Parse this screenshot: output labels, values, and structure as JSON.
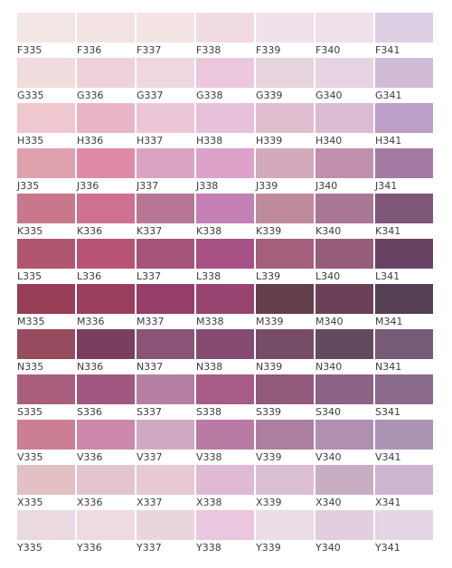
{
  "chart": {
    "rows": [
      {
        "colors": [
          "#f3e7e6",
          "#f3e3e3",
          "#f5e4e4",
          "#efdbe1",
          "#f0e1ea",
          "#efe1e9",
          "#ddd0e5"
        ],
        "codes": [
          "F335",
          "F336",
          "F337",
          "F338",
          "F339",
          "F340",
          "F341"
        ]
      },
      {
        "colors": [
          "#f0dcdc",
          "#efd1da",
          "#efd7e0",
          "#ebc8db",
          "#e8d4de",
          "#e7d3e1",
          "#d1bcd8"
        ],
        "codes": [
          "G335",
          "G336",
          "G337",
          "G338",
          "G339",
          "G340",
          "G341"
        ]
      },
      {
        "colors": [
          "#eec8ce",
          "#e9b5c9",
          "#ecc6d6",
          "#e7c0db",
          "#dfbfcf",
          "#dbbcd2",
          "#bd9ec6"
        ],
        "codes": [
          "H335",
          "H336",
          "H337",
          "H338",
          "H339",
          "H340",
          "H341"
        ]
      },
      {
        "colors": [
          "#dfa1ad",
          "#e08aa9",
          "#dba3c3",
          "#dca2ca",
          "#d3a9bb",
          "#bf8fad",
          "#a37aa2"
        ],
        "codes": [
          "J335",
          "J336",
          "J337",
          "J338",
          "J339",
          "J340",
          "J341"
        ]
      },
      {
        "colors": [
          "#c9788b",
          "#cd7092",
          "#b77694",
          "#c47fb4",
          "#c08a9e",
          "#a97795",
          "#7e5677"
        ],
        "codes": [
          "K335",
          "K336",
          "K337",
          "K338",
          "K339",
          "K340",
          "K341"
        ]
      },
      {
        "colors": [
          "#b1566f",
          "#b75376",
          "#a6547a",
          "#a75186",
          "#a35f7b",
          "#965e7b",
          "#694363"
        ],
        "codes": [
          "L335",
          "L336",
          "L337",
          "L338",
          "L339",
          "L340",
          "L341"
        ]
      },
      {
        "colors": [
          "#953e56",
          "#9a3e60",
          "#943e69",
          "#974471",
          "#643e4c",
          "#6c4157",
          "#553f53"
        ],
        "codes": [
          "M335",
          "M336",
          "M337",
          "M338",
          "M339",
          "M340",
          "M341"
        ]
      },
      {
        "colors": [
          "#974b5f",
          "#7b3d5f",
          "#8a5476",
          "#864b71",
          "#764c66",
          "#65495f",
          "#765a76"
        ],
        "codes": [
          "N335",
          "N336",
          "N337",
          "N338",
          "N339",
          "N340",
          "N341"
        ]
      },
      {
        "colors": [
          "#a95f7c",
          "#a05880",
          "#b47fa0",
          "#a65c86",
          "#91597a",
          "#8c6386",
          "#8a6a8b"
        ],
        "codes": [
          "S335",
          "S336",
          "S337",
          "S338",
          "S339",
          "S340",
          "S341"
        ]
      },
      {
        "colors": [
          "#cc7e95",
          "#cc88ab",
          "#d1a9c5",
          "#b97ba3",
          "#ac7f9e",
          "#b08fb1",
          "#ab94b3"
        ],
        "codes": [
          "V335",
          "V336",
          "V337",
          "V338",
          "V339",
          "V340",
          "V341"
        ]
      },
      {
        "colors": [
          "#e2c0c4",
          "#e4c3d0",
          "#e8c8d2",
          "#e0b9d5",
          "#dcc0d2",
          "#c8aec2",
          "#ccb5cf"
        ],
        "codes": [
          "X335",
          "X336",
          "X337",
          "X338",
          "X339",
          "X340",
          "X341"
        ]
      },
      {
        "colors": [
          "#ead9e0",
          "#eedbdf",
          "#e9d5dc",
          "#ebc6df",
          "#eadde8",
          "#e2cede",
          "#e4d6e4"
        ],
        "codes": [
          "Y335",
          "Y336",
          "Y337",
          "Y338",
          "Y339",
          "Y340",
          "Y341"
        ]
      }
    ]
  }
}
